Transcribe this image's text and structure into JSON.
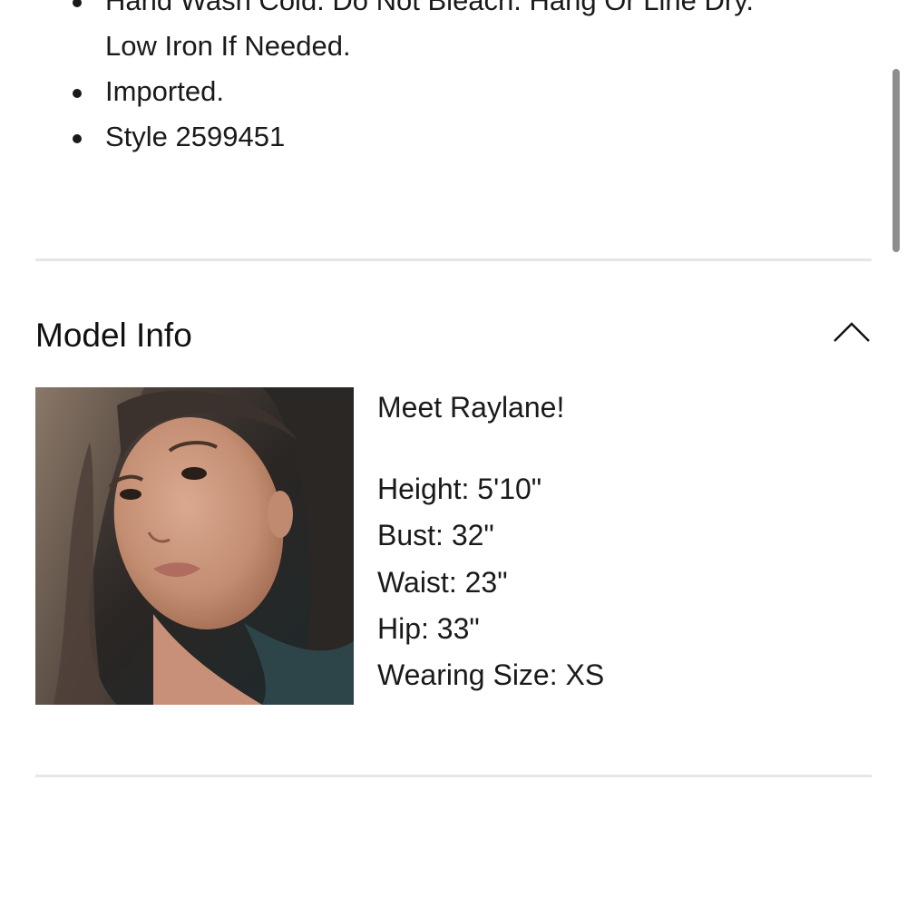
{
  "product_details": {
    "items": [
      {
        "lines": [
          "Hand Wash Cold. Do Not Bleach. Hang Or Line Dry.",
          "Low Iron If Needed."
        ]
      },
      {
        "lines": [
          "Imported."
        ]
      },
      {
        "lines": [
          "Style 2599451"
        ]
      }
    ]
  },
  "model_info": {
    "title": "Model Info",
    "toggle_icon": "chevron-up-icon",
    "greeting": "Meet Raylane!",
    "stats": [
      {
        "label": "Height",
        "value": "5'10\""
      },
      {
        "label": "Bust",
        "value": "32\""
      },
      {
        "label": "Waist",
        "value": "23\""
      },
      {
        "label": "Hip",
        "value": "33\""
      },
      {
        "label": "Wearing Size",
        "value": "XS"
      }
    ]
  },
  "colors": {
    "text": "#1a1a1a",
    "divider": "#e6e6e6",
    "scrollbar": "#8e8e8e"
  }
}
